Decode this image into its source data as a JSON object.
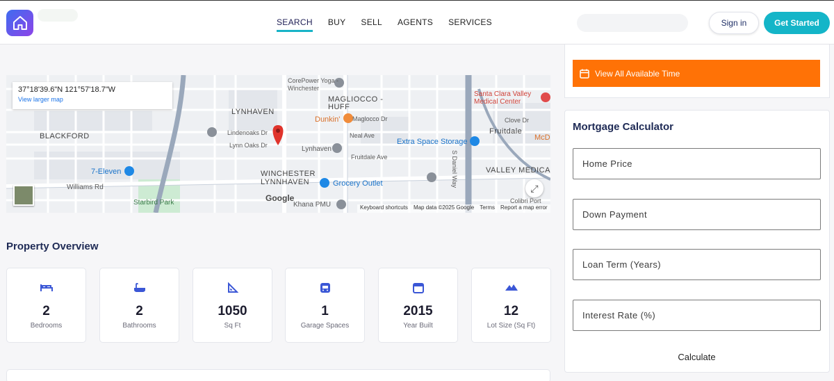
{
  "header": {
    "logo_icon": "house-icon",
    "nav": [
      {
        "label": "SEARCH",
        "active": true
      },
      {
        "label": "BUY",
        "active": false
      },
      {
        "label": "SELL",
        "active": false
      },
      {
        "label": "AGENTS",
        "active": false
      },
      {
        "label": "SERVICES",
        "active": false
      }
    ],
    "signin_label": "Sign in",
    "get_started_label": "Get Started",
    "accent_color": "#14b5c8"
  },
  "map": {
    "coordinates": "37°18'39.6\"N 121°57'18.7\"W",
    "view_larger": "View larger map",
    "google": "Google",
    "attribution": [
      "Keyboard shortcuts",
      "Map data ©2025 Google",
      "Terms",
      "Report a map error"
    ],
    "areas": [
      "LYNHAVEN",
      "MAGLIOCCO - HUFF",
      "BLACKFORD",
      "WINCHESTER",
      "LYNNHAVEN",
      "VALLEY MEDICAL",
      "Fruitdale"
    ],
    "places": [
      "CorePower Yoga - Winchester",
      "Dunkin'",
      "Extra Space Storage",
      "7-Eleven",
      "Grocery Outlet",
      "Khana PMU",
      "Santa Clara Valley Medical Center",
      "Starbird Park",
      "Lynhaven",
      "McD"
    ],
    "streets": [
      "Lindenoaks Dr",
      "Lynn Oaks Dr",
      "Maglocco Dr",
      "Neal Ave",
      "Fruitdale Ave",
      "Williams Rd",
      "Clove Dr",
      "Colibri Port",
      "S Daniel Way"
    ]
  },
  "overview": {
    "title": "Property Overview",
    "cards": [
      {
        "icon": "bed-icon",
        "value": "2",
        "label": "Bedrooms"
      },
      {
        "icon": "bath-icon",
        "value": "2",
        "label": "Bathrooms"
      },
      {
        "icon": "ruler-icon",
        "value": "1050",
        "label": "Sq Ft"
      },
      {
        "icon": "garage-icon",
        "value": "1",
        "label": "Garage Spaces"
      },
      {
        "icon": "calendar-icon",
        "value": "2015",
        "label": "Year Built"
      },
      {
        "icon": "mountain-icon",
        "value": "12",
        "label": "Lot Size (Sq Ft)"
      }
    ]
  },
  "sidebar": {
    "view_time_label": "View All Available Time",
    "view_time_color": "#ff7206",
    "calculator": {
      "title": "Mortgage Calculator",
      "home_price_placeholder": "Home Price",
      "down_payment_placeholder": "Down Payment",
      "loan_term_placeholder": "Loan Term (Years)",
      "interest_rate_placeholder": "Interest Rate (%)",
      "calculate_label": "Calculate"
    }
  }
}
